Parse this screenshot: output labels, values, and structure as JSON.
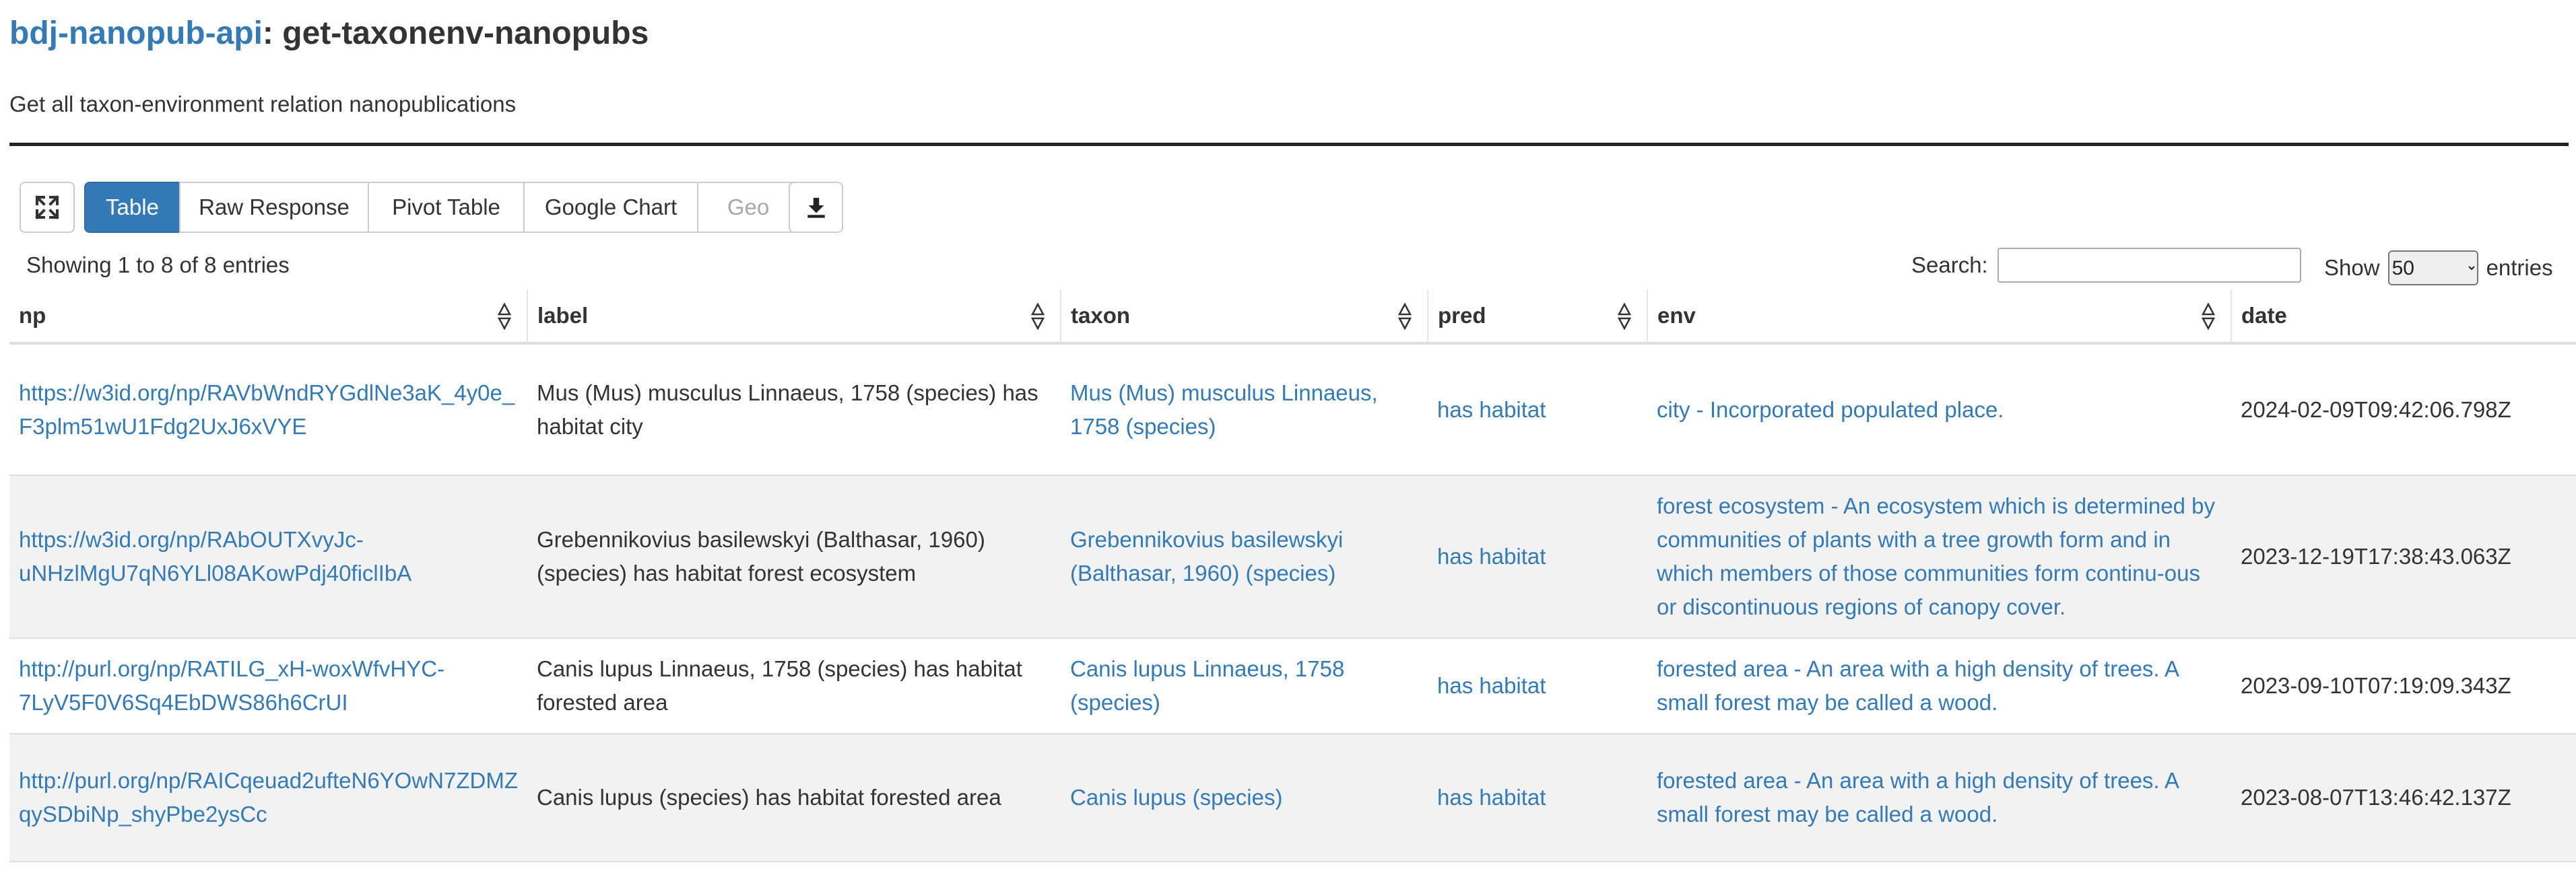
{
  "header": {
    "api_link": "bdj-nanopub-api",
    "separator": ": ",
    "query_name": "get-taxonenv-nanopubs",
    "description": "Get all taxon-environment relation nanopublications"
  },
  "toolbar": {
    "fullscreen_icon": "expand-icon",
    "download_icon": "download-icon",
    "tabs": [
      {
        "label": "Table",
        "state": "active"
      },
      {
        "label": "Raw Response",
        "state": "normal"
      },
      {
        "label": "Pivot Table",
        "state": "normal"
      },
      {
        "label": "Google Chart",
        "state": "normal"
      },
      {
        "label": "Geo",
        "state": "disabled"
      }
    ]
  },
  "table_controls": {
    "info": "Showing 1 to 8 of 8 entries",
    "search_label": "Search:",
    "search_value": "",
    "show_label": "Show",
    "page_length": "50",
    "entries_label": "entries"
  },
  "columns": [
    "np",
    "label",
    "taxon",
    "pred",
    "env",
    "date"
  ],
  "rows": [
    {
      "np": "https://w3id.org/np/RAVbWndRYGdlNe3aK_4y0e_F3plm51wU1Fdg2UxJ6xVYE",
      "label": "Mus (Mus) musculus Linnaeus, 1758 (species) has habitat city",
      "taxon": "Mus (Mus) musculus Linnaeus, 1758 (species)",
      "pred": "has habitat",
      "env": "city - Incorporated populated place.",
      "date": "2024-02-09T09:42:06.798Z"
    },
    {
      "np": "https://w3id.org/np/RAbOUTXvyJc-uNHzlMgU7qN6YLl08AKowPdj40ficlIbA",
      "label": "Grebennikovius basilewskyi (Balthasar, 1960) (species) has habitat forest ecosystem",
      "taxon": "Grebennikovius basilewskyi (Balthasar, 1960) (species)",
      "pred": "has habitat",
      "env": "forest ecosystem - An ecosystem which is determined by communities of plants with a tree growth form and in which members of those communities form continu-ous or discontinuous regions of canopy cover.",
      "date": "2023-12-19T17:38:43.063Z"
    },
    {
      "np": "http://purl.org/np/RATILG_xH-woxWfvHYC-7LyV5F0V6Sq4EbDWS86h6CrUI",
      "label": "Canis lupus Linnaeus, 1758 (species) has habitat forested area",
      "taxon": "Canis lupus Linnaeus, 1758 (species)",
      "pred": "has habitat",
      "env": "forested area - An area with a high density of trees. A small forest may be called a wood.",
      "date": "2023-09-10T07:19:09.343Z"
    },
    {
      "np": "http://purl.org/np/RAICqeuad2ufteN6YOwN7ZDMZqySDbiNp_shyPbe2ysCc",
      "label": "Canis lupus (species) has habitat forested area",
      "taxon": "Canis lupus (species)",
      "pred": "has habitat",
      "env": "forested area - An area with a high density of trees. A small forest may be called a wood.",
      "date": "2023-08-07T13:46:42.137Z"
    }
  ]
}
